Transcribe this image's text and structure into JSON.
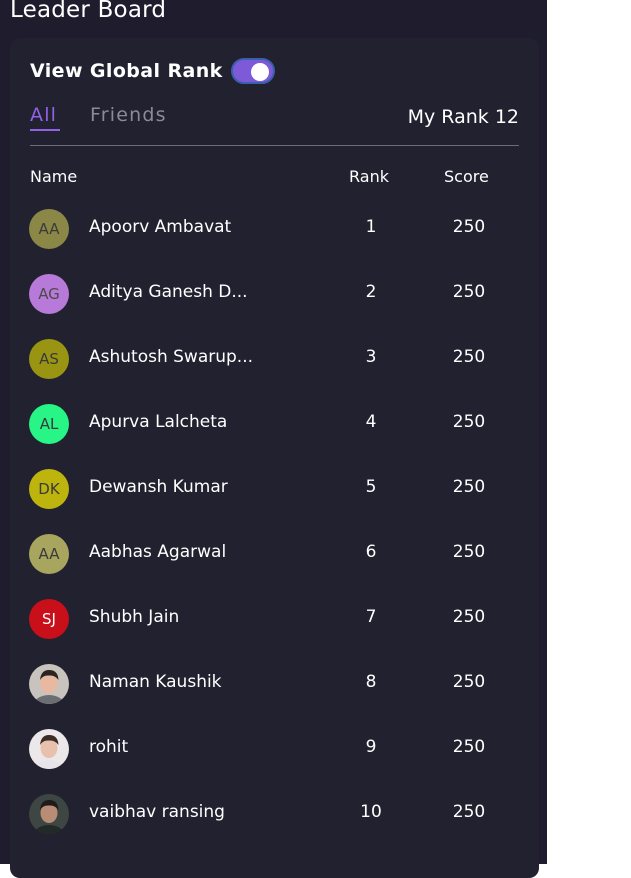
{
  "page_title": "Leader Board",
  "global_rank": {
    "label": "View Global Rank",
    "enabled": true
  },
  "tabs": [
    {
      "label": "All",
      "active": true
    },
    {
      "label": "Friends",
      "active": false
    }
  ],
  "my_rank": "My Rank 12",
  "columns": {
    "name": "Name",
    "rank": "Rank",
    "score": "Score"
  },
  "colors": {
    "accent": "#8f62e8",
    "background": "#1e1c2d",
    "card": "#22212f"
  },
  "players": [
    {
      "initials": "AA",
      "name": "Apoorv Ambavat",
      "rank": "1",
      "score": "250",
      "avatar_color": "#8b8746",
      "avatar_text_color": "#3a3a3a"
    },
    {
      "initials": "AG",
      "name": "Aditya Ganesh D...",
      "rank": "2",
      "score": "250",
      "avatar_color": "#b87ad8",
      "avatar_text_color": "#4a4a4a"
    },
    {
      "initials": "AS",
      "name": "Ashutosh Swarup...",
      "rank": "3",
      "score": "250",
      "avatar_color": "#9a9413",
      "avatar_text_color": "#3a3a3a"
    },
    {
      "initials": "AL",
      "name": "Apurva Lalcheta",
      "rank": "4",
      "score": "250",
      "avatar_color": "#27f585",
      "avatar_text_color": "#3a3a3a"
    },
    {
      "initials": "DK",
      "name": "Dewansh Kumar",
      "rank": "5",
      "score": "250",
      "avatar_color": "#bdb40d",
      "avatar_text_color": "#3a3a3a"
    },
    {
      "initials": "AA",
      "name": "Aabhas Agarwal",
      "rank": "6",
      "score": "250",
      "avatar_color": "#a8a55e",
      "avatar_text_color": "#3a3a3a"
    },
    {
      "initials": "SJ",
      "name": "Shubh Jain",
      "rank": "7",
      "score": "250",
      "avatar_color": "#c80f1a",
      "avatar_text_color": "#ffffff"
    },
    {
      "initials": "",
      "name": "Naman Kaushik",
      "rank": "8",
      "score": "250",
      "avatar_photo": "user-photo-icon"
    },
    {
      "initials": "",
      "name": "rohit",
      "rank": "9",
      "score": "250",
      "avatar_photo": "user-photo-icon"
    },
    {
      "initials": "",
      "name": "vaibhav ransing",
      "rank": "10",
      "score": "250",
      "avatar_photo": "user-photo-icon"
    }
  ]
}
